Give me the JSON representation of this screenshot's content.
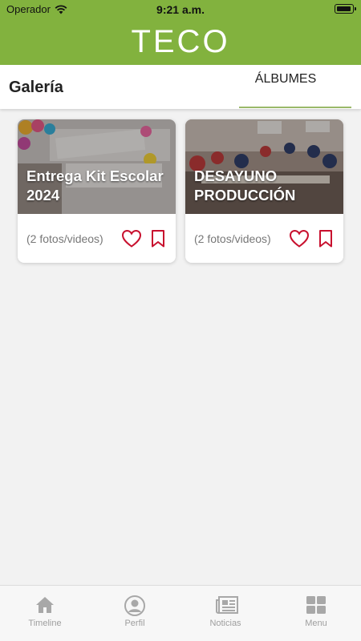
{
  "status_bar": {
    "carrier": "Operador",
    "time": "9:21 a.m."
  },
  "header": {
    "logo": "TECO",
    "brand_color": "#82b23e"
  },
  "subheader": {
    "title": "Galería",
    "tab": "ÁLBUMES"
  },
  "albums": [
    {
      "title": "Entrega Kit Escolar 2024",
      "count": "(2 fotos/videos)"
    },
    {
      "title": "DESAYUNO PRODUCCIÓN",
      "count": "(2 fotos/videos)"
    }
  ],
  "tab_bar": [
    {
      "label": "Timeline",
      "icon": "home-icon"
    },
    {
      "label": "Perfil",
      "icon": "profile-icon"
    },
    {
      "label": "Noticias",
      "icon": "newspaper-icon"
    },
    {
      "label": "Menu",
      "icon": "grid-icon"
    }
  ],
  "colors": {
    "accent": "#82b23e",
    "action": "#c8102e",
    "tab_inactive": "#9e9e9e"
  }
}
